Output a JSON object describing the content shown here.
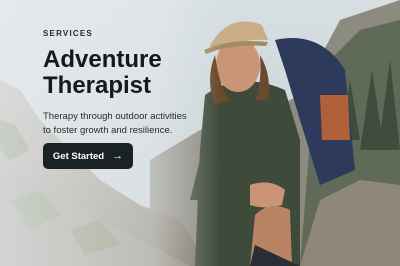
{
  "hero": {
    "eyebrow": "SERVICES",
    "title_line1": "Adventure",
    "title_line2": "Therapist",
    "description": "Therapy through outdoor activities to foster growth and resilience.",
    "cta_label": "Get Started",
    "cta_icon": "arrow-right-icon"
  },
  "colors": {
    "button_bg": "#1b2225",
    "text_dark": "#111a1c"
  }
}
